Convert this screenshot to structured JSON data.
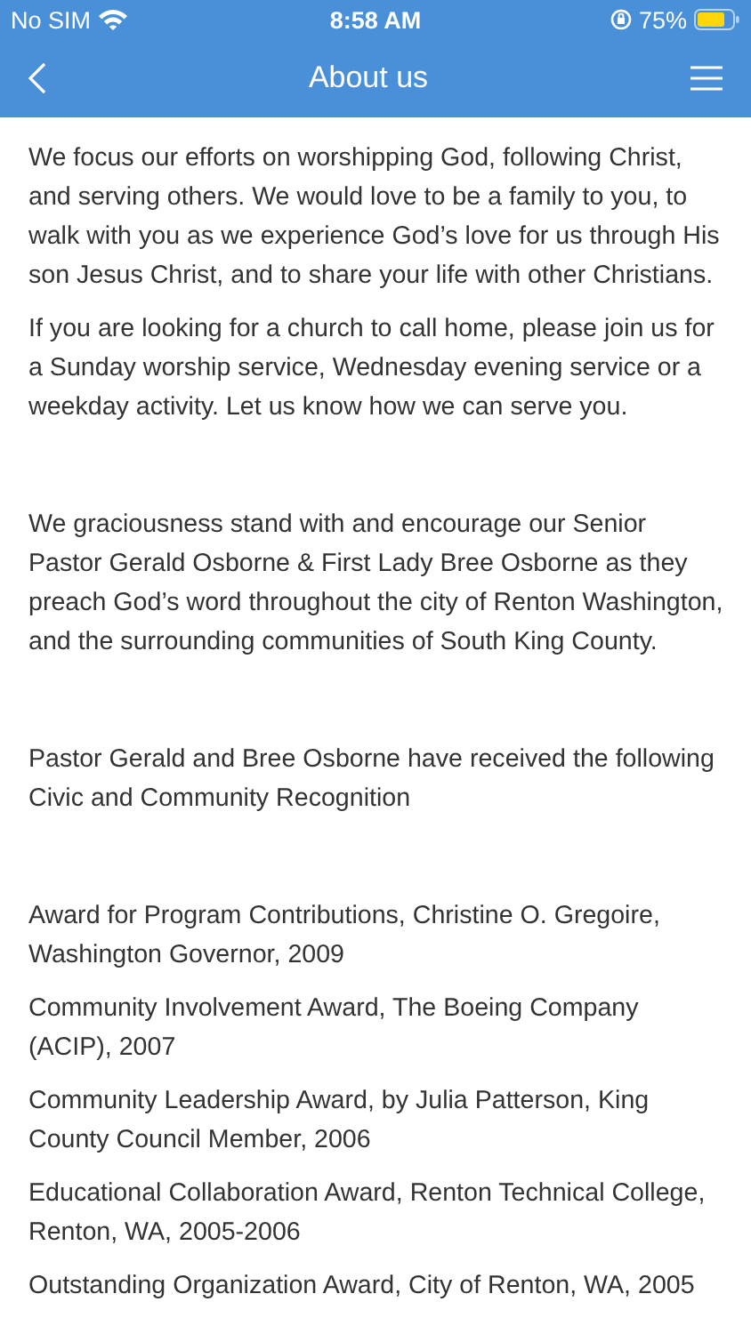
{
  "status_bar": {
    "carrier": "No SIM",
    "time": "8:58 AM",
    "battery": "75%"
  },
  "header": {
    "title": "About us"
  },
  "sections": [
    {
      "paragraphs": [
        "We focus our efforts on worshipping God, following Christ, and serving others.  We would love to be a family to you, to walk with you as we experience God’s love for us through His son Jesus Christ, and to share your life with other Christians.",
        "If you are looking for a church to call home, please join us for a Sunday worship service, Wednesday evening service or a weekday activity.  Let us know how we can serve you."
      ]
    },
    {
      "paragraphs": [
        "We graciousness stand with and encourage our Senior Pastor Gerald Osborne & First Lady Bree Osborne as they preach God’s word throughout the city of Renton Washington, and the surrounding communities of South King County."
      ]
    },
    {
      "paragraphs": [
        "Pastor Gerald and Bree Osborne have received the following Civic and Community Recognition"
      ]
    },
    {
      "paragraphs": [
        "Award for Program Contributions, Christine O. Gregoire, Washington Governor, 2009",
        "Community Involvement Award, The Boeing Company (ACIP), 2007",
        "Community Leadership Award, by Julia Patterson, King County Council Member, 2006",
        "Educational Collaboration Award, Renton Technical College, Renton, WA, 2005-2006",
        "Outstanding Organization Award, City of Renton, WA, 2005"
      ]
    }
  ]
}
